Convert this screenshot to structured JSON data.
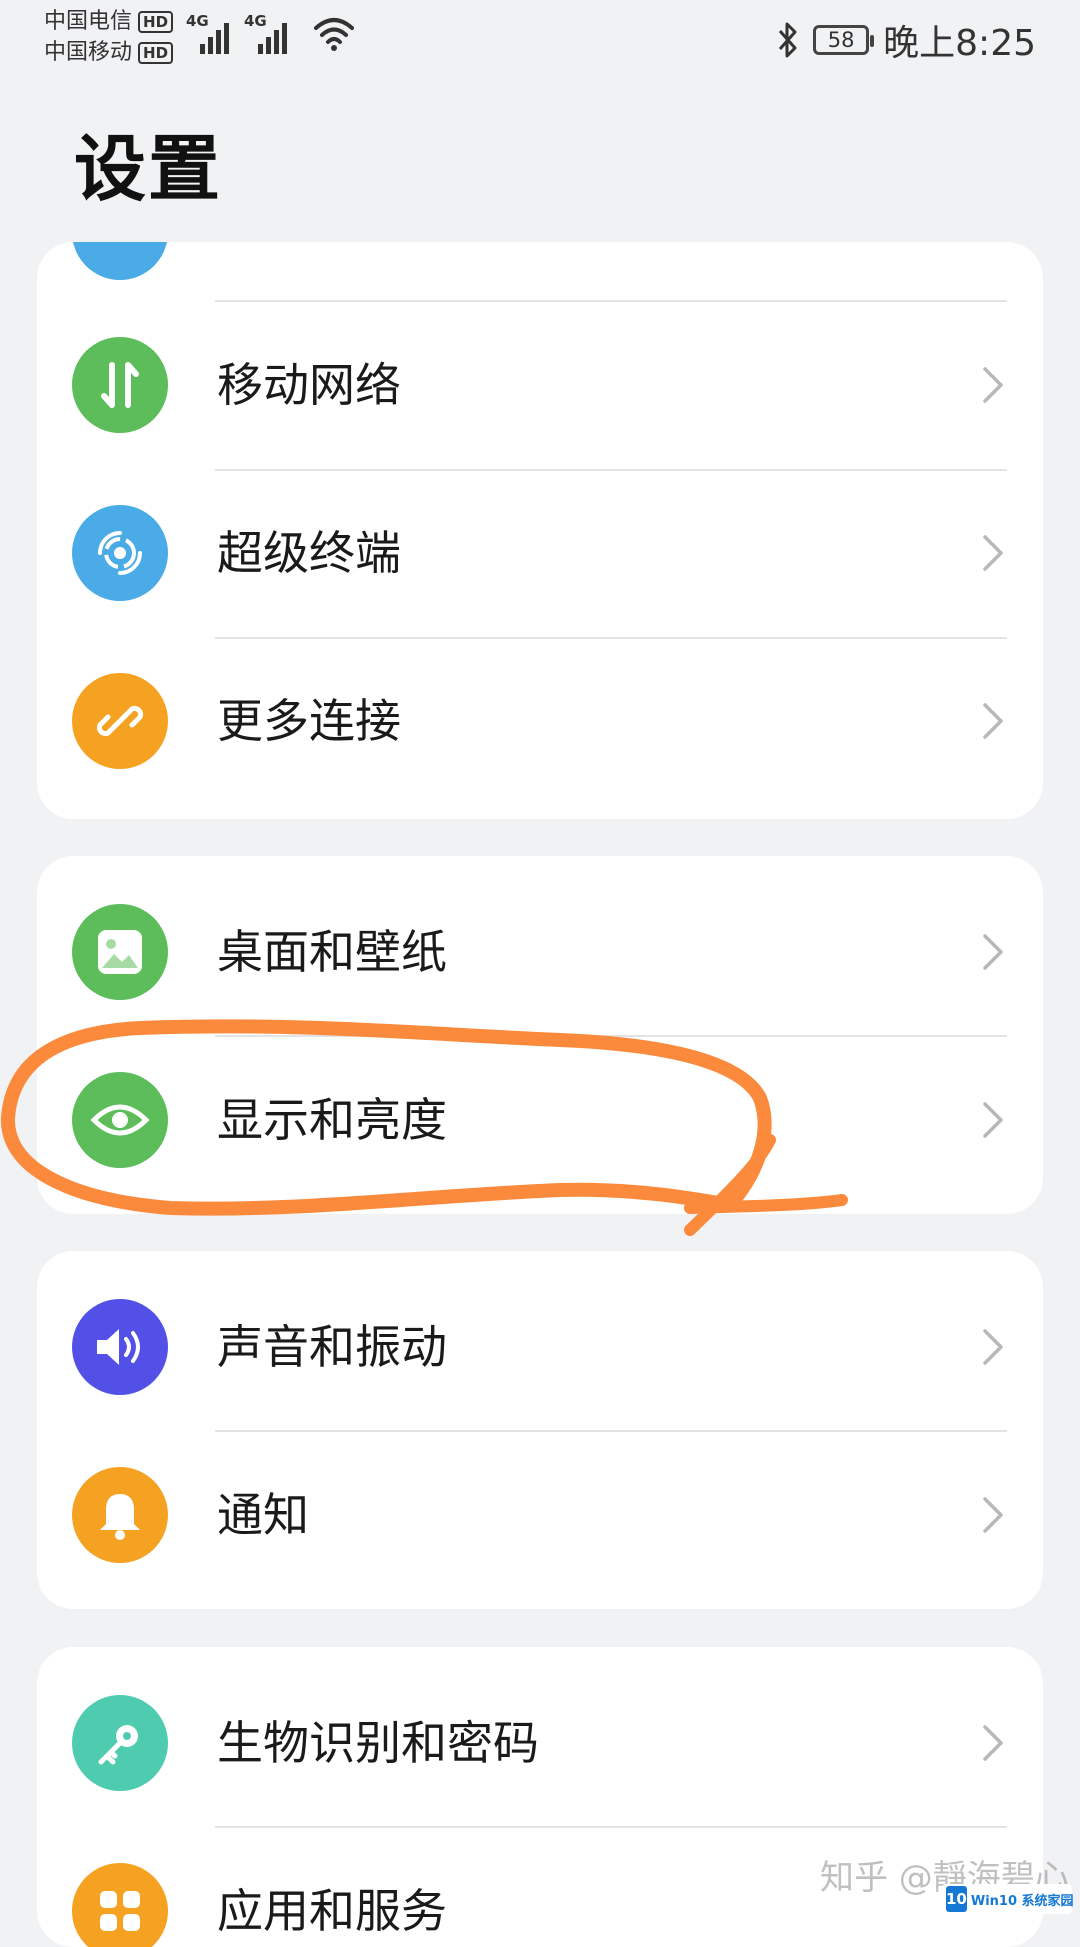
{
  "status_bar": {
    "carrier_1": "中国电信",
    "carrier_2": "中国移动",
    "hd_label": "HD",
    "network_type_1": "4G",
    "network_type_2": "4G",
    "battery": "58",
    "time": "晚上8:25"
  },
  "page": {
    "title": "设置"
  },
  "groups": [
    {
      "items": [
        {
          "label": "移动网络",
          "icon": "mobile-data-icon",
          "color": "#5cbd5a"
        },
        {
          "label": "超级终端",
          "icon": "super-device-icon",
          "color": "#4aabe6"
        },
        {
          "label": "更多连接",
          "icon": "link-icon",
          "color": "#f5a223"
        }
      ]
    },
    {
      "items": [
        {
          "label": "桌面和壁纸",
          "icon": "wallpaper-icon",
          "color": "#5cbd5a"
        },
        {
          "label": "显示和亮度",
          "icon": "eye-icon",
          "color": "#5cbd5a"
        }
      ]
    },
    {
      "items": [
        {
          "label": "声音和振动",
          "icon": "speaker-icon",
          "color": "#5350e8"
        },
        {
          "label": "通知",
          "icon": "bell-icon",
          "color": "#f5a223"
        }
      ]
    },
    {
      "items": [
        {
          "label": "生物识别和密码",
          "icon": "key-icon",
          "color": "#4fcbb0"
        },
        {
          "label": "应用和服务",
          "icon": "apps-icon",
          "color": "#f5a223"
        }
      ]
    }
  ],
  "annotation": {
    "color": "#fb8a3c"
  },
  "watermark": {
    "text": "知乎 @靜海碧心",
    "logo_text": "Win10 系统家园"
  }
}
